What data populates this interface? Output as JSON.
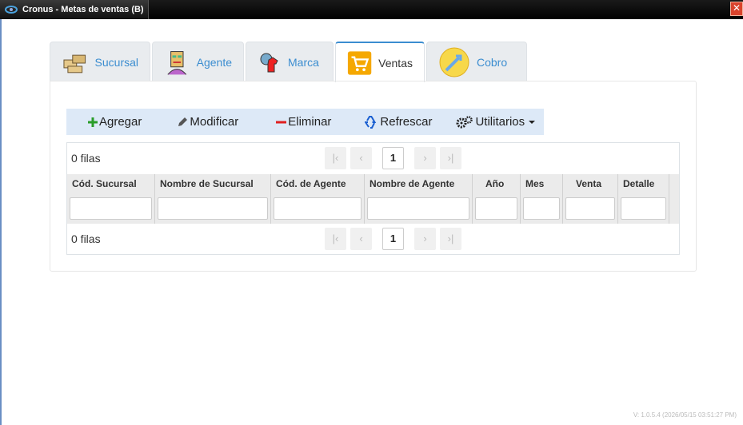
{
  "window": {
    "title": "Cronus - Metas de ventas (B)",
    "close_glyph": "✕"
  },
  "tabs": [
    {
      "label": "Sucursal",
      "icon": "building-icon"
    },
    {
      "label": "Agente",
      "icon": "agent-icon"
    },
    {
      "label": "Marca",
      "icon": "brand-icon"
    },
    {
      "label": "Ventas",
      "icon": "cart-icon",
      "active": true
    },
    {
      "label": "Cobro",
      "icon": "coin-icon"
    }
  ],
  "toolbar": {
    "add_label": "Agregar",
    "edit_label": "Modificar",
    "delete_label": "Eliminar",
    "refresh_label": "Refrescar",
    "utilities_label": "Utilitarios"
  },
  "pager_top": {
    "rows_label": "0 filas",
    "page": "1"
  },
  "pager_bottom": {
    "rows_label": "0 filas",
    "page": "1"
  },
  "pager_glyphs": {
    "first": "|‹",
    "prev": "‹",
    "next": "›",
    "last": "›|"
  },
  "columns": [
    "Cód. Sucursal",
    "Nombre de Sucursal",
    "Cód. de Agente",
    "Nombre de Agente",
    "Año",
    "Mes",
    "Venta",
    "Detalle"
  ],
  "version": "V: 1.0.5.4 (2026/05/15 03:51:27 PM)",
  "colors": {
    "accent": "#3b8dd0",
    "toolbar_bg": "#dde9f7",
    "add": "#2a9d2a",
    "delete": "#e02020"
  }
}
